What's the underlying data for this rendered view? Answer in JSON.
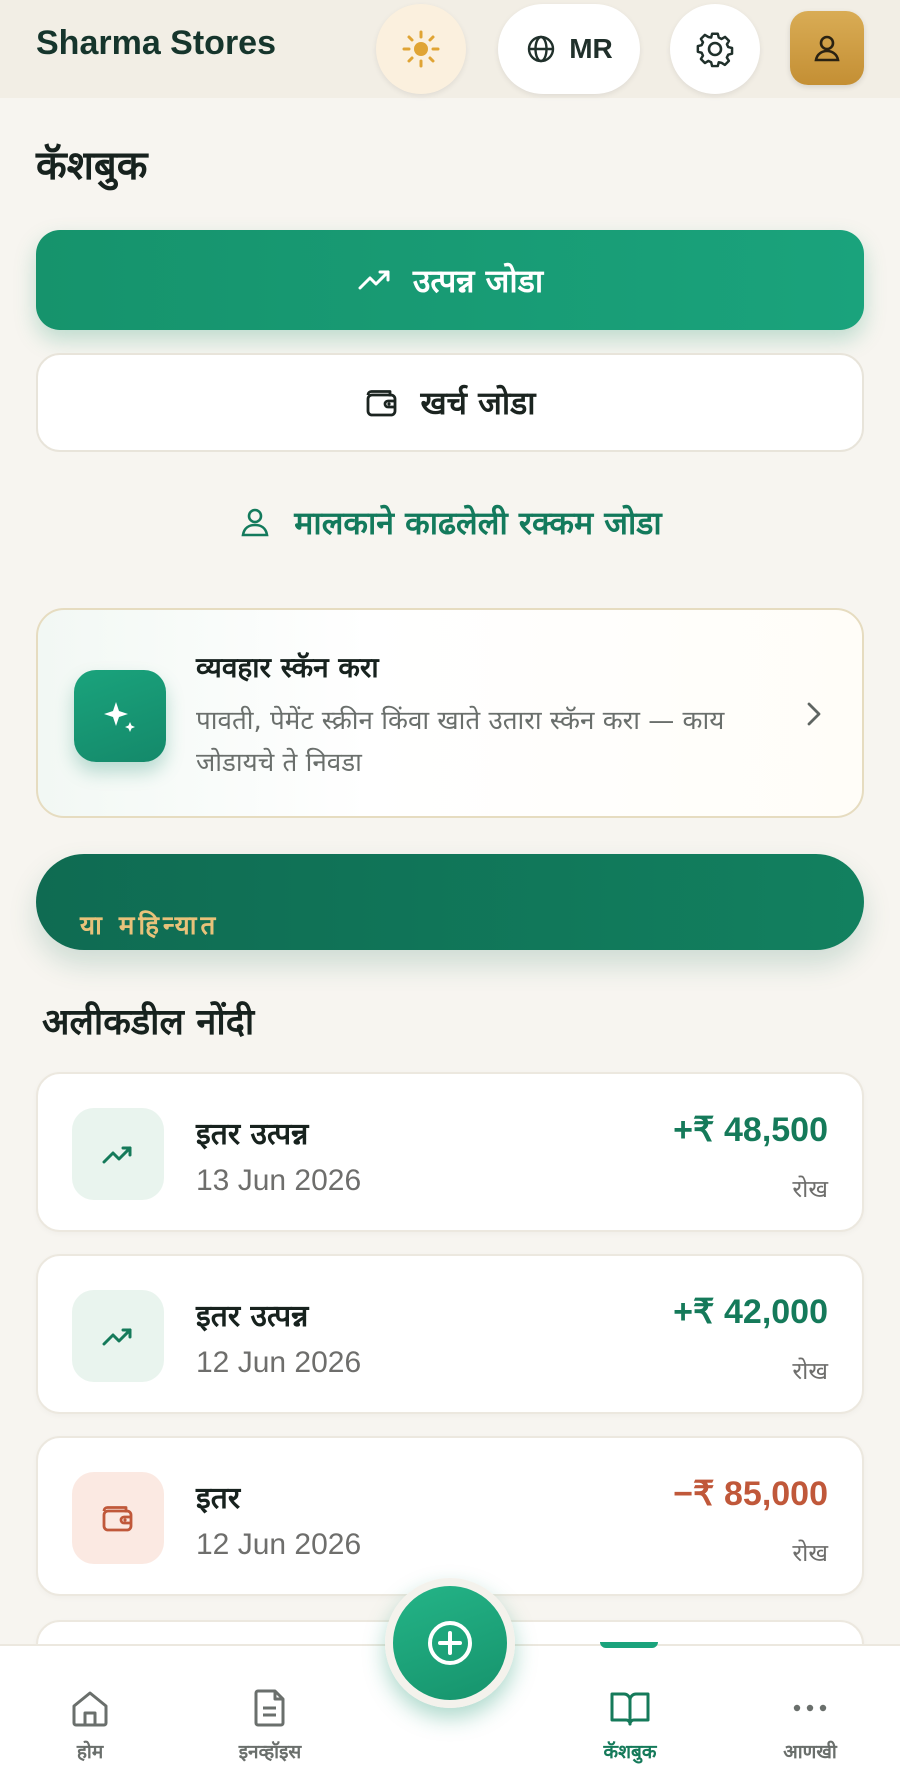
{
  "header": {
    "brand": "Sharma Stores",
    "language_code": "MR",
    "icons": {
      "theme": "sun-icon",
      "language": "globe-icon",
      "settings": "gear-icon",
      "account": "user-icon"
    }
  },
  "page": {
    "title": "कॅशबुक"
  },
  "actions": {
    "add_income": "उत्पन्न जोडा",
    "add_expense": "खर्च जोडा",
    "add_owner_withdrawal": "मालकाने काढलेली रक्कम जोडा"
  },
  "scan_card": {
    "title": "व्यवहार स्कॅन करा",
    "description": "पावती, पेमेंट स्क्रीन किंवा खाते उतारा स्कॅन करा — काय जोडायचे ते निवडा"
  },
  "month_summary": {
    "label": "या महिन्यात"
  },
  "recent": {
    "title": "अलीकडील नोंदी",
    "entries": [
      {
        "name": "इतर उत्पन्न",
        "date": "13 Jun 2026",
        "amount": "+₹ 48,500",
        "mode": "रोख",
        "type": "income"
      },
      {
        "name": "इतर उत्पन्न",
        "date": "12 Jun 2026",
        "amount": "+₹ 42,000",
        "mode": "रोख",
        "type": "income"
      },
      {
        "name": "इतर",
        "date": "12 Jun 2026",
        "amount": "−₹ 85,000",
        "mode": "रोख",
        "type": "expense"
      }
    ]
  },
  "bottom_nav": {
    "items": [
      {
        "label": "होम",
        "icon": "home-icon"
      },
      {
        "label": "इनव्हॉइस",
        "icon": "document-icon"
      },
      {
        "label": "कॅशबुक",
        "icon": "book-icon",
        "active": true
      },
      {
        "label": "आणखी",
        "icon": "more-icon"
      }
    ],
    "fab_icon": "plus-circle-icon"
  },
  "colors": {
    "primary": "#16936c",
    "income": "#157a5a",
    "expense": "#c0583a",
    "accent_gold": "#e8c27a",
    "background": "#f7f5f0"
  }
}
